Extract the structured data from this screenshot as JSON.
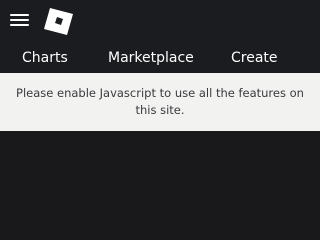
{
  "header": {
    "menu_icon": "hamburger-menu-icon",
    "logo_icon": "roblox-logo-icon"
  },
  "nav": {
    "items": [
      {
        "label": "Charts"
      },
      {
        "label": "Marketplace"
      },
      {
        "label": "Create"
      }
    ]
  },
  "notice": {
    "text": "Please enable Javascript to use all the features on this site."
  },
  "colors": {
    "header_bg": "#1b1c1f",
    "page_bg": "#19191b",
    "notice_bg": "#f2f2f1",
    "notice_text": "#393b3d",
    "nav_text": "#ffffff"
  }
}
